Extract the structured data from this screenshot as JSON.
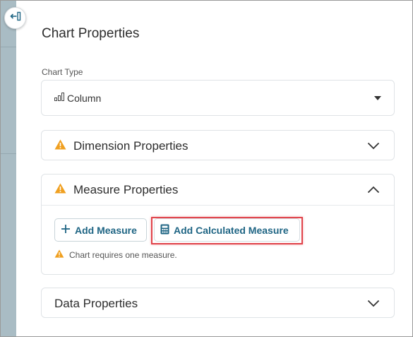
{
  "panel": {
    "title": "Chart Properties",
    "collapse_icon": "collapse-panel-icon"
  },
  "chart_type": {
    "label": "Chart Type",
    "value": "Column",
    "icon": "column-chart-icon"
  },
  "sections": {
    "dimension": {
      "title": "Dimension Properties",
      "expanded": false,
      "warning": true
    },
    "measure": {
      "title": "Measure Properties",
      "expanded": true,
      "warning": true,
      "add_measure_label": "Add Measure",
      "add_calculated_label": "Add Calculated Measure",
      "hint": "Chart requires one measure."
    },
    "data": {
      "title": "Data Properties",
      "expanded": false,
      "warning": false
    }
  },
  "colors": {
    "accent": "#1f6584",
    "warning": "#f0a020",
    "highlight": "#e0434a",
    "strip": "#a9bcc4"
  }
}
